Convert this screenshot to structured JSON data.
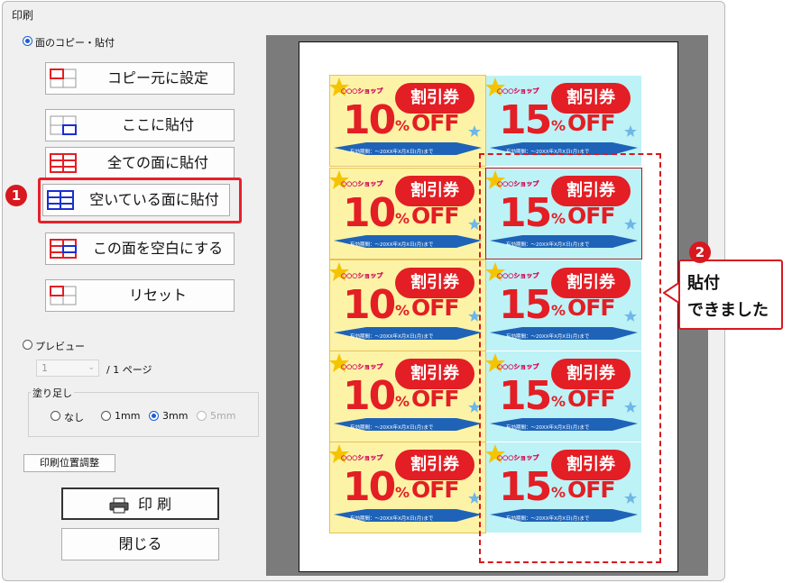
{
  "dialog": {
    "title": "印刷"
  },
  "mode": {
    "copy_paste_label": "面のコピー・貼付",
    "preview_label": "プレビュー"
  },
  "buttons": {
    "set_source": "コピー元に設定",
    "paste_here": "ここに貼付",
    "paste_all": "全ての面に貼付",
    "paste_empty": "空いている面に貼付",
    "clear_face": "この面を空白にする",
    "reset": "リセット",
    "print_position": "印刷位置調整",
    "print": "印 刷",
    "close": "閉じる"
  },
  "preview": {
    "page_value": "1",
    "page_total": "/ 1 ページ"
  },
  "bleed": {
    "legend": "塗り足し",
    "options": [
      "なし",
      "1mm",
      "3mm",
      "5mm"
    ],
    "selected": "3mm"
  },
  "annotations": {
    "step1": "1",
    "step2": "2",
    "callout_line1": "貼付",
    "callout_line2": "できました"
  },
  "coupons": {
    "shop": "○○○ショップ",
    "title": "割引券",
    "percent": "%",
    "off": "OFF",
    "validity": "有効期間：～20XX年X月X日(月)まで",
    "left_value": "10",
    "right_value": "15"
  },
  "colors": {
    "accent_red": "#d8181f",
    "coupon_red": "#e31e24",
    "coupon_left_bg": "#fdf3a6",
    "coupon_right_bg": "#bdf2f6",
    "selection_blue": "#1a5fd1"
  }
}
